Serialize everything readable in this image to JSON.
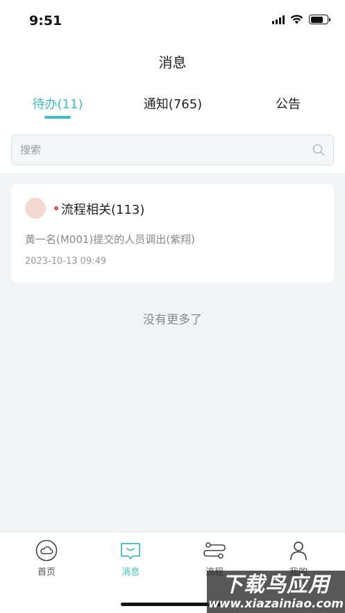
{
  "status_bar": {
    "time": "9:51"
  },
  "header": {
    "title": "消息"
  },
  "tabs": [
    {
      "label": "待办(11)",
      "active": true
    },
    {
      "label": "通知(765)",
      "active": false
    },
    {
      "label": "公告",
      "active": false
    }
  ],
  "search": {
    "placeholder": "搜索",
    "value": ""
  },
  "messages": [
    {
      "title": "流程相关(113)",
      "description": "黄一名(M001)提交的人员调出(紫翔)",
      "time": "2023-10-13 09:49",
      "unread": true
    }
  ],
  "list_footer": "没有更多了",
  "tabbar": [
    {
      "label": "首页",
      "icon": "cloud-icon",
      "active": false
    },
    {
      "label": "消息",
      "icon": "message-icon",
      "active": true
    },
    {
      "label": "流程",
      "icon": "flow-icon",
      "active": false
    },
    {
      "label": "我的",
      "icon": "person-icon",
      "active": false
    }
  ],
  "watermark": {
    "main": "下载鸟应用",
    "url": "www.xiazainiao.com"
  },
  "colors": {
    "accent": "#3bbfc2",
    "unread_dot": "#e84d4d",
    "avatar": "#f3d9cf"
  }
}
